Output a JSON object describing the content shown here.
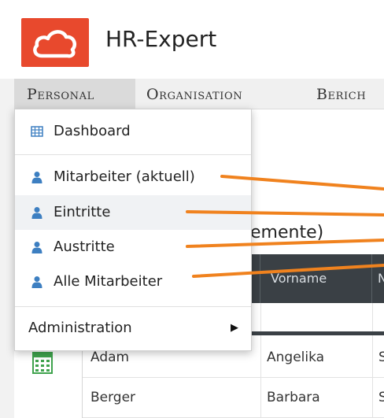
{
  "app": {
    "title": "HR-Expert",
    "logo_icon": "cloud-icon",
    "brand_color": "#e8492d"
  },
  "menubar": {
    "items": [
      {
        "label": "Personal",
        "active": true
      },
      {
        "label": "Organisation",
        "active": false
      },
      {
        "label": "Berich",
        "active": false
      }
    ]
  },
  "dropdown": {
    "items": [
      {
        "label": "Dashboard",
        "icon": "grid-icon"
      },
      {
        "label": "Mitarbeiter (aktuell)",
        "icon": "person-icon"
      },
      {
        "label": "Eintritte",
        "icon": "person-icon"
      },
      {
        "label": "Austritte",
        "icon": "person-icon"
      },
      {
        "label": "Alle Mitarbeiter",
        "icon": "person-icon"
      },
      {
        "label": "Administration",
        "icon": "chevron-right-icon"
      }
    ],
    "submenu_arrow": "▶"
  },
  "background": {
    "title_fragment": "emente)",
    "table": {
      "headers": [
        "",
        "Vorname",
        "N"
      ],
      "rows": [
        [
          "Adam",
          "Angelika",
          "S"
        ],
        [
          "Berger",
          "Barbara",
          "S"
        ]
      ]
    }
  },
  "colors": {
    "annotation": "#f0821e",
    "table_header": "#3a4045",
    "icon_blue": "#3d7fc1"
  }
}
